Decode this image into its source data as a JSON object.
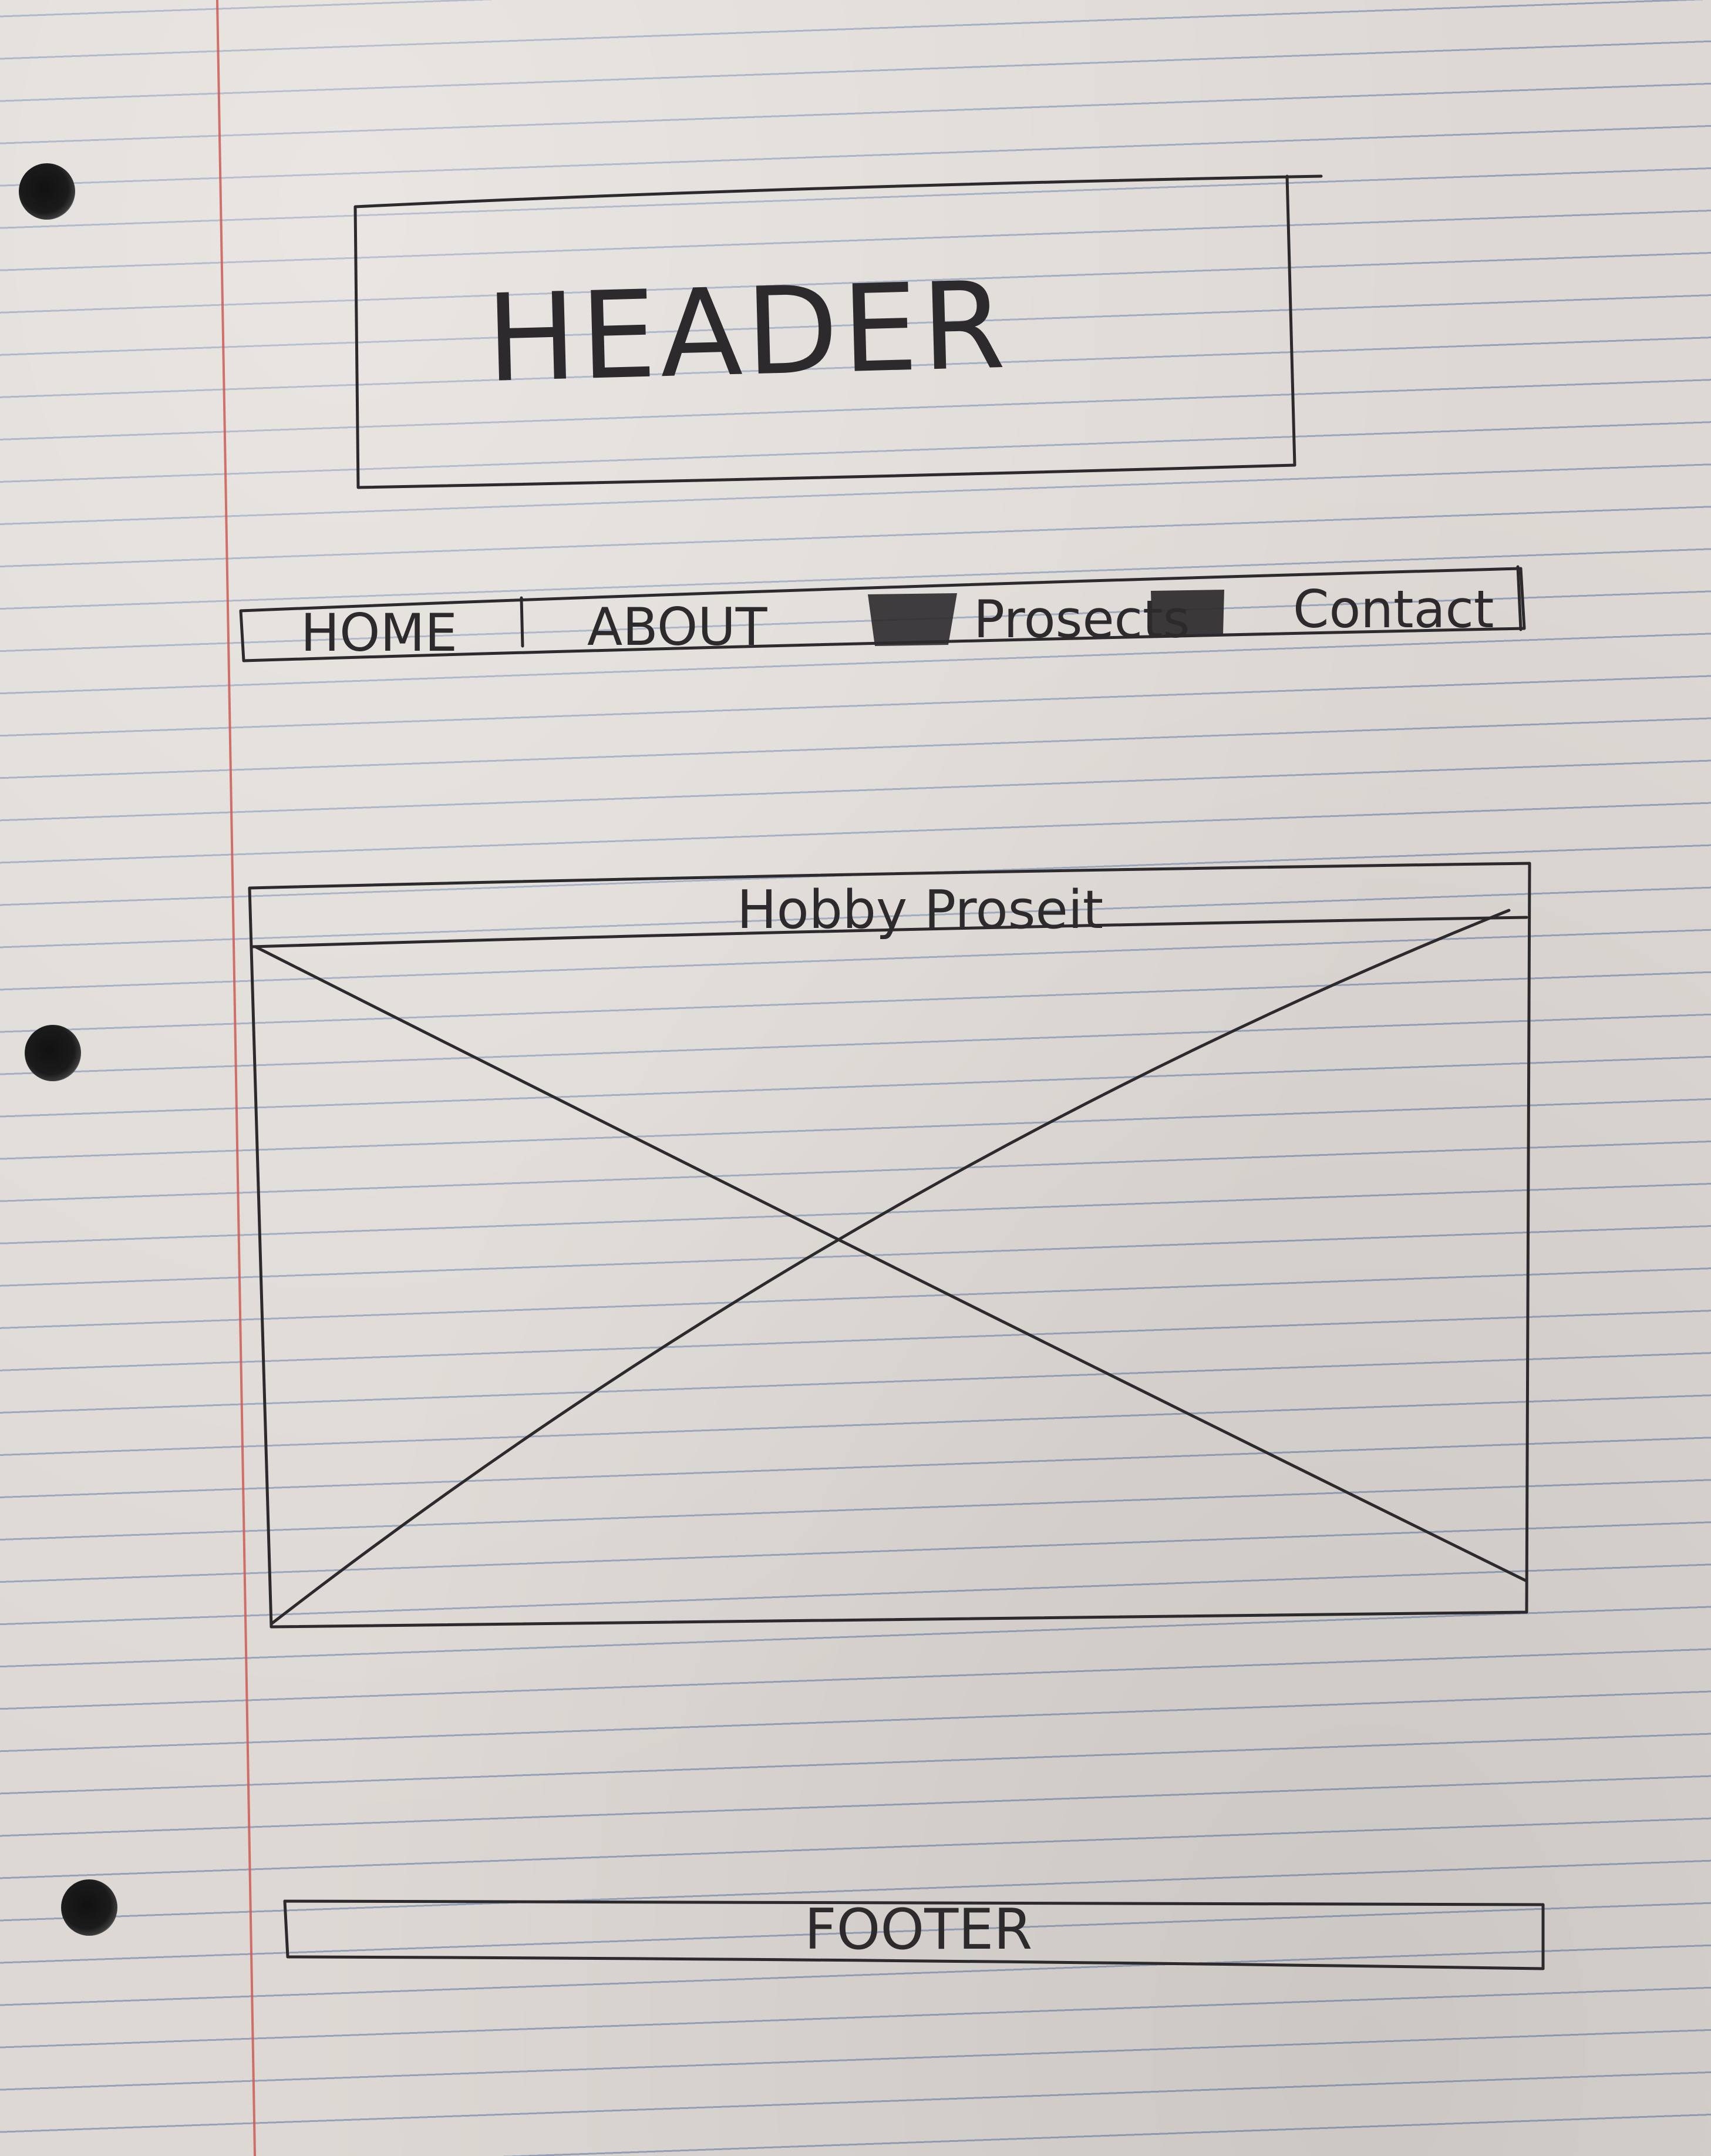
{
  "header": {
    "label": "HEADER"
  },
  "nav": {
    "items": [
      {
        "label": "HOME"
      },
      {
        "label": "ABOUT"
      },
      {
        "label": "Prosects"
      },
      {
        "label": "Contact"
      }
    ]
  },
  "hobby": {
    "title": "Hobby Proseit"
  },
  "footer": {
    "label": "FOOTER"
  },
  "colors": {
    "ink": "#2c2a2c",
    "paper": "#ddd8d3",
    "rule": "#5c76a2",
    "margin": "#cd5a55"
  }
}
